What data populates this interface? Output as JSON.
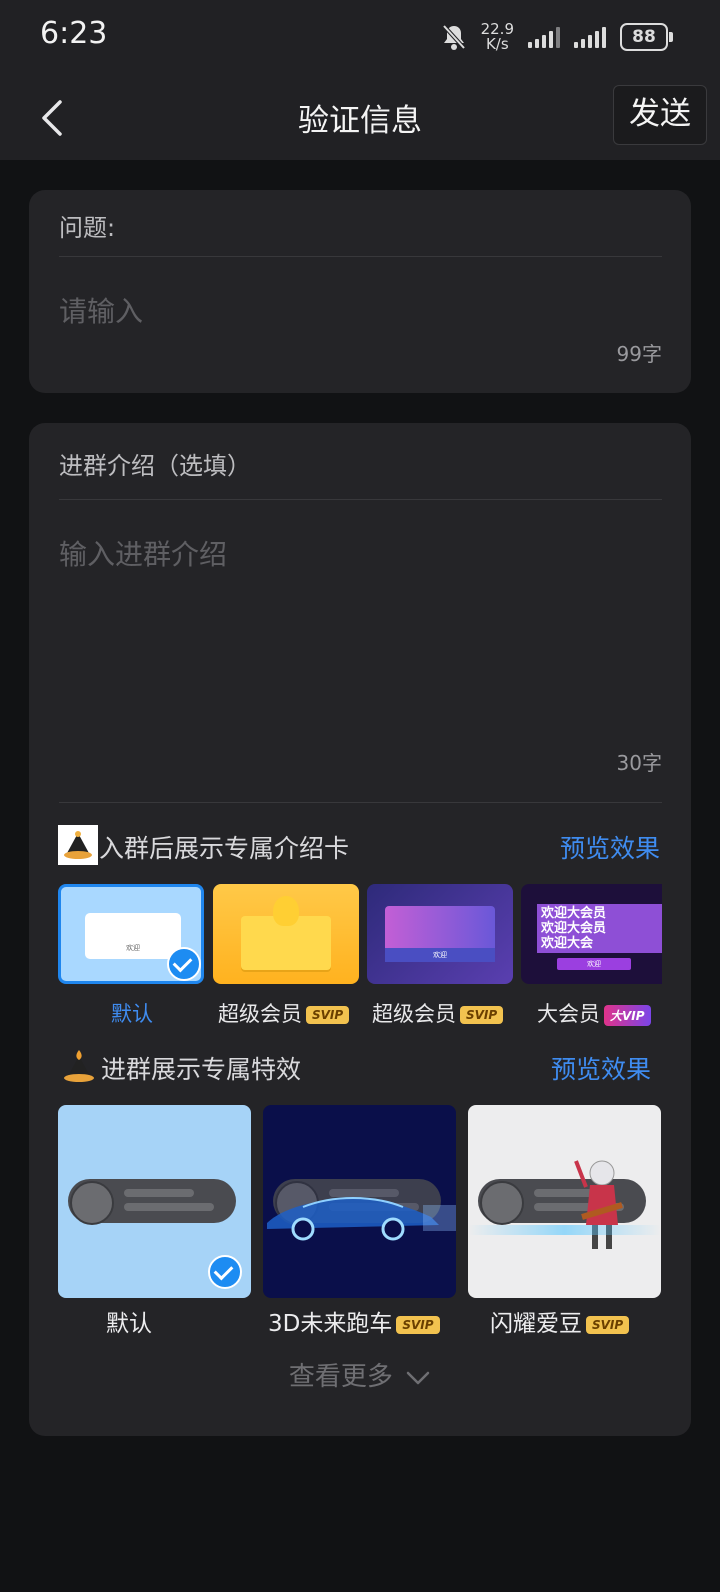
{
  "status_bar": {
    "time": "6:23",
    "speed_value": "22.9",
    "speed_unit": "K/s",
    "battery": "88"
  },
  "header": {
    "title": "验证信息",
    "send_label": "发送"
  },
  "question_section": {
    "label": "问题:",
    "placeholder": "请输入",
    "counter": "99字"
  },
  "intro_section": {
    "label": "进群介绍（选填）",
    "placeholder": "输入进群介绍",
    "counter": "30字"
  },
  "intro_card_section": {
    "title": "入群后展示专属介绍卡",
    "preview_label": "预览效果",
    "cards": [
      {
        "label": "默认",
        "badge": "",
        "selected": true
      },
      {
        "label": "超级会员",
        "badge": "SVIP"
      },
      {
        "label": "超级会员",
        "badge": "SVIP"
      },
      {
        "label": "大会员",
        "badge": "大VIP"
      }
    ],
    "card_text": "欢迎",
    "welcome_banner": [
      "欢迎大会员",
      "欢迎大会员",
      "欢迎大会"
    ]
  },
  "effect_section": {
    "title": "进群展示专属特效",
    "preview_label": "预览效果",
    "effects": [
      {
        "label": "默认",
        "badge": "",
        "selected": true
      },
      {
        "label": "3D未来跑车",
        "badge": "SVIP"
      },
      {
        "label": "闪耀爱豆",
        "badge": "SVIP"
      }
    ]
  },
  "more_label": "查看更多",
  "colors": {
    "accent_blue": "#3f8cf0",
    "svip_gold": "#f2c24f",
    "background": "#111214",
    "card": "#242427"
  },
  "icons": [
    "back-arrow-icon",
    "mute-bell-icon",
    "signal-icon",
    "battery-icon",
    "check-icon",
    "chevron-down-icon"
  ]
}
